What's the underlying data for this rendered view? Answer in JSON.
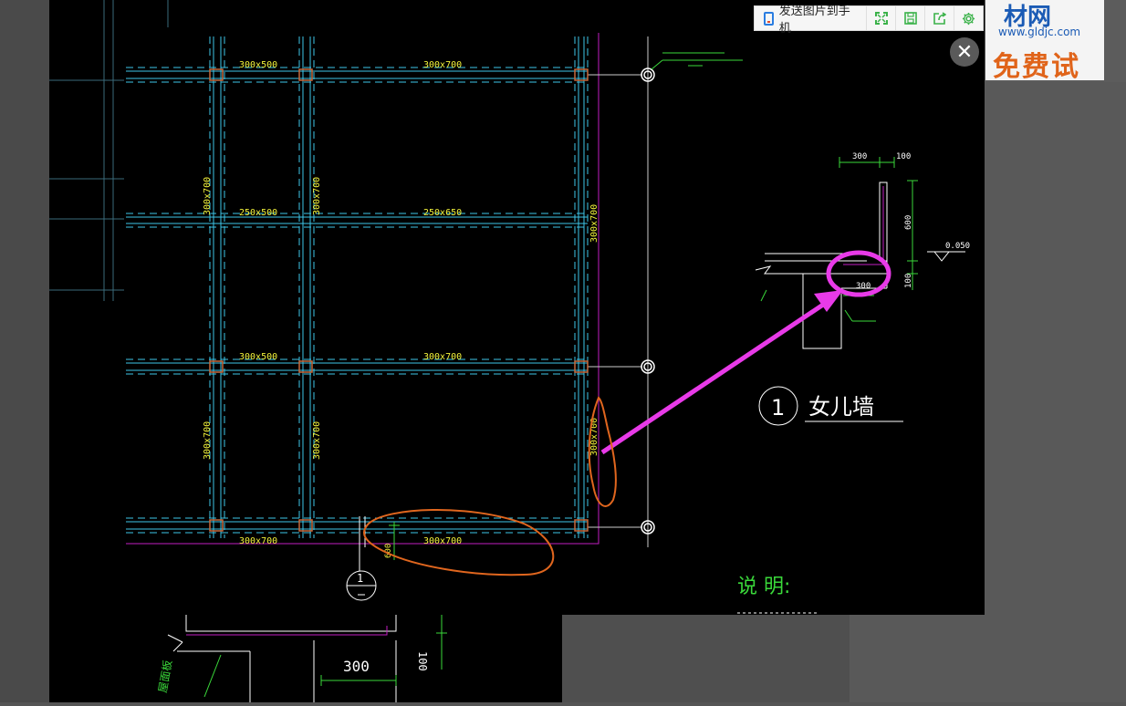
{
  "toolbar": {
    "send_label": "发送图片到手机",
    "icons": [
      "phone-icon",
      "fullscreen-icon",
      "save-icon",
      "share-icon",
      "settings-icon"
    ]
  },
  "close_button": {
    "glyph": "✕"
  },
  "ad": {
    "brand": "材网",
    "url": "www.gldjc.com",
    "slogan": "免费试用"
  },
  "drawing": {
    "beams_top": [
      "300x500",
      "300x700"
    ],
    "beams_second": [
      "250x500",
      "250x650"
    ],
    "beams_third": [
      "300x500",
      "300x700"
    ],
    "beams_bottom": [
      "300x700",
      "300x700"
    ],
    "vertical_beams": [
      "300x700",
      "300x700",
      "300x700",
      "300x700",
      "300x700",
      "300x700"
    ],
    "dim_600_a": "600",
    "detail": {
      "dims": [
        "300",
        "100",
        "600",
        "100",
        "300"
      ],
      "elevation": "0.050",
      "callout_number": "1",
      "title": "女儿墙"
    },
    "notes_title": "说 明:",
    "lower_dim": "300",
    "lower_side_dim": "100",
    "lower_label": "屋面板"
  },
  "colors": {
    "beam_text": "#f2f23a",
    "grid_cyan": "#3ec6e8",
    "boundary_magenta": "#c21ec2",
    "annotation_magenta": "#e83ae8",
    "annotation_orange": "#e0661e",
    "column_orange": "#c8683a",
    "green": "#3ad83a"
  }
}
